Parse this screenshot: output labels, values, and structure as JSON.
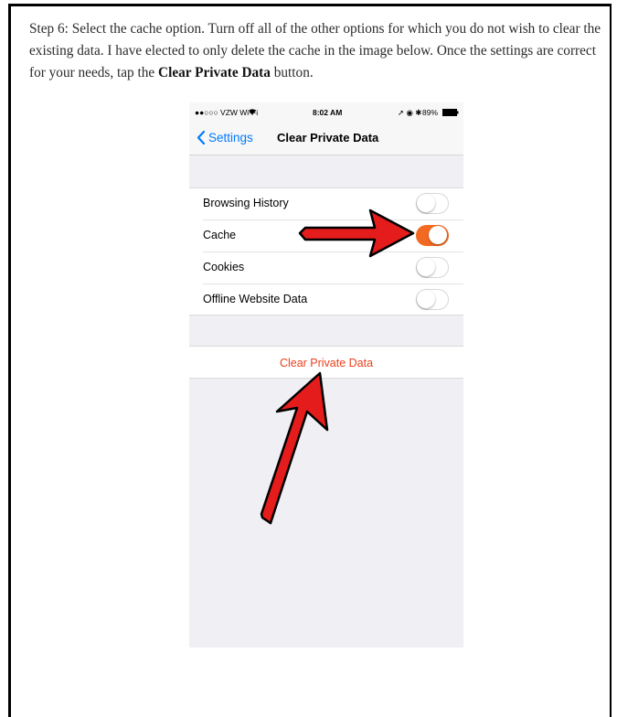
{
  "article": {
    "text_before": "Step 6: Select the cache option. Turn off all of the other options for which you do not wish to clear the existing data. I have elected to only delete the cache in the image below. Once the settings are correct for your needs, tap the ",
    "bold": "Clear Private Data",
    "text_after": " button."
  },
  "status_bar": {
    "carrier": "●●○○○ VZW Wi-Fi",
    "time": "8:02 AM",
    "battery": "89%"
  },
  "nav": {
    "back_label": "Settings",
    "title": "Clear Private Data"
  },
  "settings": [
    {
      "label": "Browsing History",
      "on": false
    },
    {
      "label": "Cache",
      "on": true
    },
    {
      "label": "Cookies",
      "on": false
    },
    {
      "label": "Offline Website Data",
      "on": false
    }
  ],
  "action": {
    "label": "Clear Private Data"
  },
  "colors": {
    "accent_toggle": "#f26a21",
    "action_text": "#e8401c",
    "ios_blue": "#007aff",
    "annotation_arrow": "#e41c1c"
  }
}
